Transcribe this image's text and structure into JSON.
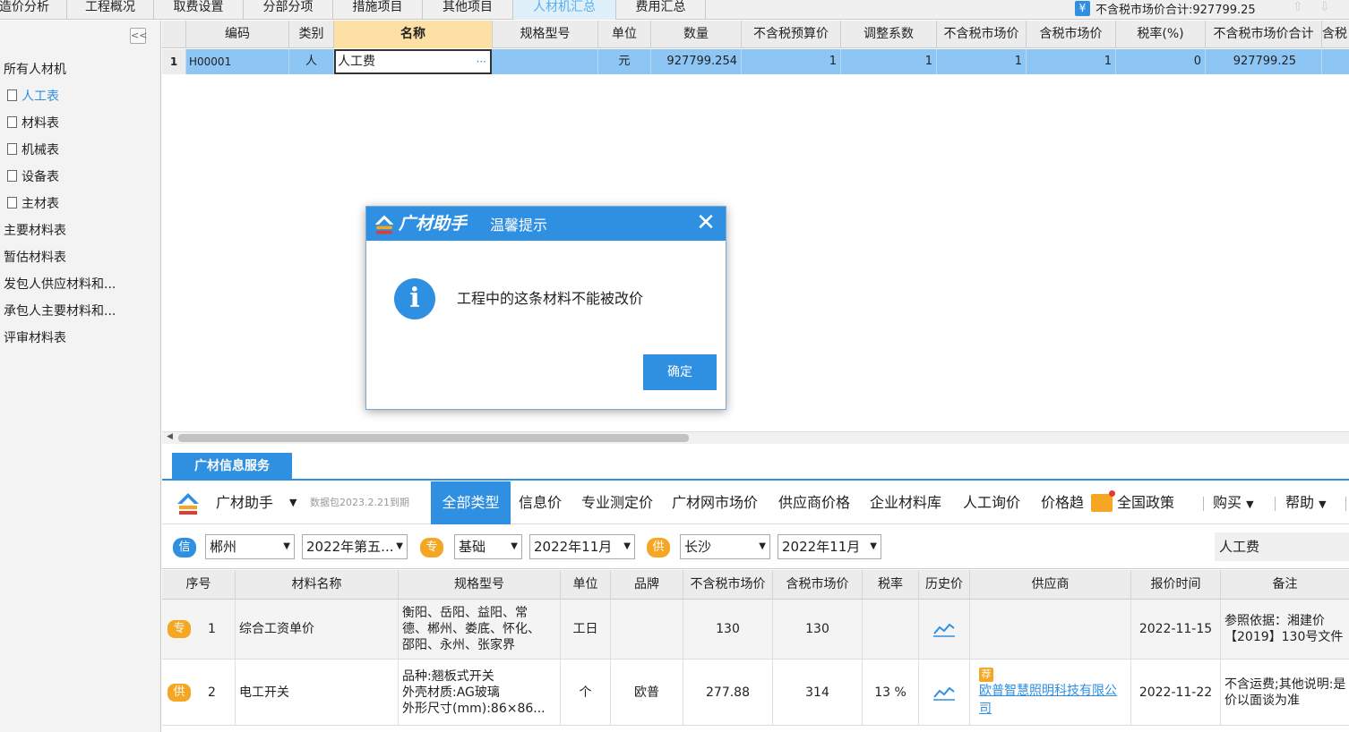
{
  "top_tabs": [
    {
      "label": "造价分析"
    },
    {
      "label": "工程概况"
    },
    {
      "label": "取费设置"
    },
    {
      "label": "分部分项"
    },
    {
      "label": "措施项目"
    },
    {
      "label": "其他项目"
    },
    {
      "label": "人材机汇总",
      "active": true
    },
    {
      "label": "费用汇总"
    }
  ],
  "tax_summary": {
    "icon": "yen-icon",
    "text": "不含税市场价合计:927799.25"
  },
  "left_tree": {
    "collapse": "<<",
    "items": [
      {
        "label": "所有人材机"
      },
      {
        "label": "人工表",
        "selected": true
      },
      {
        "label": "材料表"
      },
      {
        "label": "机械表"
      },
      {
        "label": "设备表"
      },
      {
        "label": "主材表"
      },
      {
        "label": "主要材料表"
      },
      {
        "label": "暂估材料表"
      },
      {
        "label": "发包人供应材料和..."
      },
      {
        "label": "承包人主要材料和..."
      },
      {
        "label": "评审材料表"
      }
    ]
  },
  "grid": {
    "headers": [
      "编码",
      "类别",
      "名称",
      "规格型号",
      "单位",
      "数量",
      "不含税预算价",
      "调整系数",
      "不含税市场价",
      "含税市场价",
      "税率(%)",
      "不含税市场价合计",
      "含税"
    ],
    "rows": [
      {
        "num": "1",
        "code": "H00001",
        "type": "人",
        "name": "人工费",
        "spec": "",
        "unit": "元",
        "qty": "927799.254",
        "budget_price": "1",
        "adjust": "1",
        "market_price": "1",
        "market_tax_price": "1",
        "tax_rate": "0",
        "total": "927799.25"
      }
    ],
    "ellipsis": "···"
  },
  "info_service": {
    "tab": "广材信息服务"
  },
  "toolbar": {
    "brand": "广材助手",
    "package": "数据包2023.2.21到期",
    "items": [
      "全部类型",
      "信息价",
      "专业测定价",
      "广材网市场价",
      "供应商价格",
      "企业材料库",
      "人工询价",
      "价格趋",
      "全国政策"
    ],
    "buy": "购买",
    "help": "帮助"
  },
  "filters": {
    "badge_info": "信",
    "region1": "郴州",
    "period1": "2022年第五...",
    "badge_pro": "专",
    "category": "基础",
    "period2": "2022年11月",
    "badge_sup": "供",
    "region2": "长沙",
    "period3": "2022年11月",
    "search": "人工费"
  },
  "bottom_table": {
    "headers": [
      "序号",
      "材料名称",
      "规格型号",
      "单位",
      "品牌",
      "不含税市场价",
      "含税市场价",
      "税率",
      "历史价",
      "供应商",
      "报价时间",
      "备注"
    ],
    "rows": [
      {
        "badge": "专",
        "num": "1",
        "name": "综合工资单价",
        "spec": [
          "衡阳、岳阳、益阳、常",
          "德、郴州、娄底、怀化、",
          "邵阳、永州、张家界"
        ],
        "unit": "工日",
        "brand": "",
        "price": "130",
        "tax_price": "130",
        "tax_rate": "",
        "supplier_badge": "",
        "supplier": [
          "",
          ""
        ],
        "time": "2022-11-15",
        "note": [
          "参照依据：湘建价",
          "【2019】130号文件"
        ]
      },
      {
        "badge": "供",
        "num": "2",
        "name": "电工开关",
        "spec": [
          "品种:翘板式开关",
          "外壳材质:AG玻璃",
          "外形尺寸(mm):86×86..."
        ],
        "unit": "个",
        "brand": "欧普",
        "price": "277.88",
        "tax_price": "314",
        "tax_rate": "13 %",
        "supplier_badge": "荐",
        "supplier": [
          "欧普智慧照明科技有限公",
          "司"
        ],
        "time": "2022-11-22",
        "note": [
          "不含运费;其他说明:是",
          "价以面谈为准"
        ]
      }
    ]
  },
  "dialog": {
    "brand": "广材助手",
    "title": "温馨提示",
    "close": "✕",
    "icon": "i",
    "message": "工程中的这条材料不能被改价",
    "ok": "确定"
  },
  "colors": {
    "accent": "#2f8fe0",
    "selected_row": "#8dc6f5",
    "name_header": "#fde0a3",
    "badge_orange": "#f5a623"
  }
}
